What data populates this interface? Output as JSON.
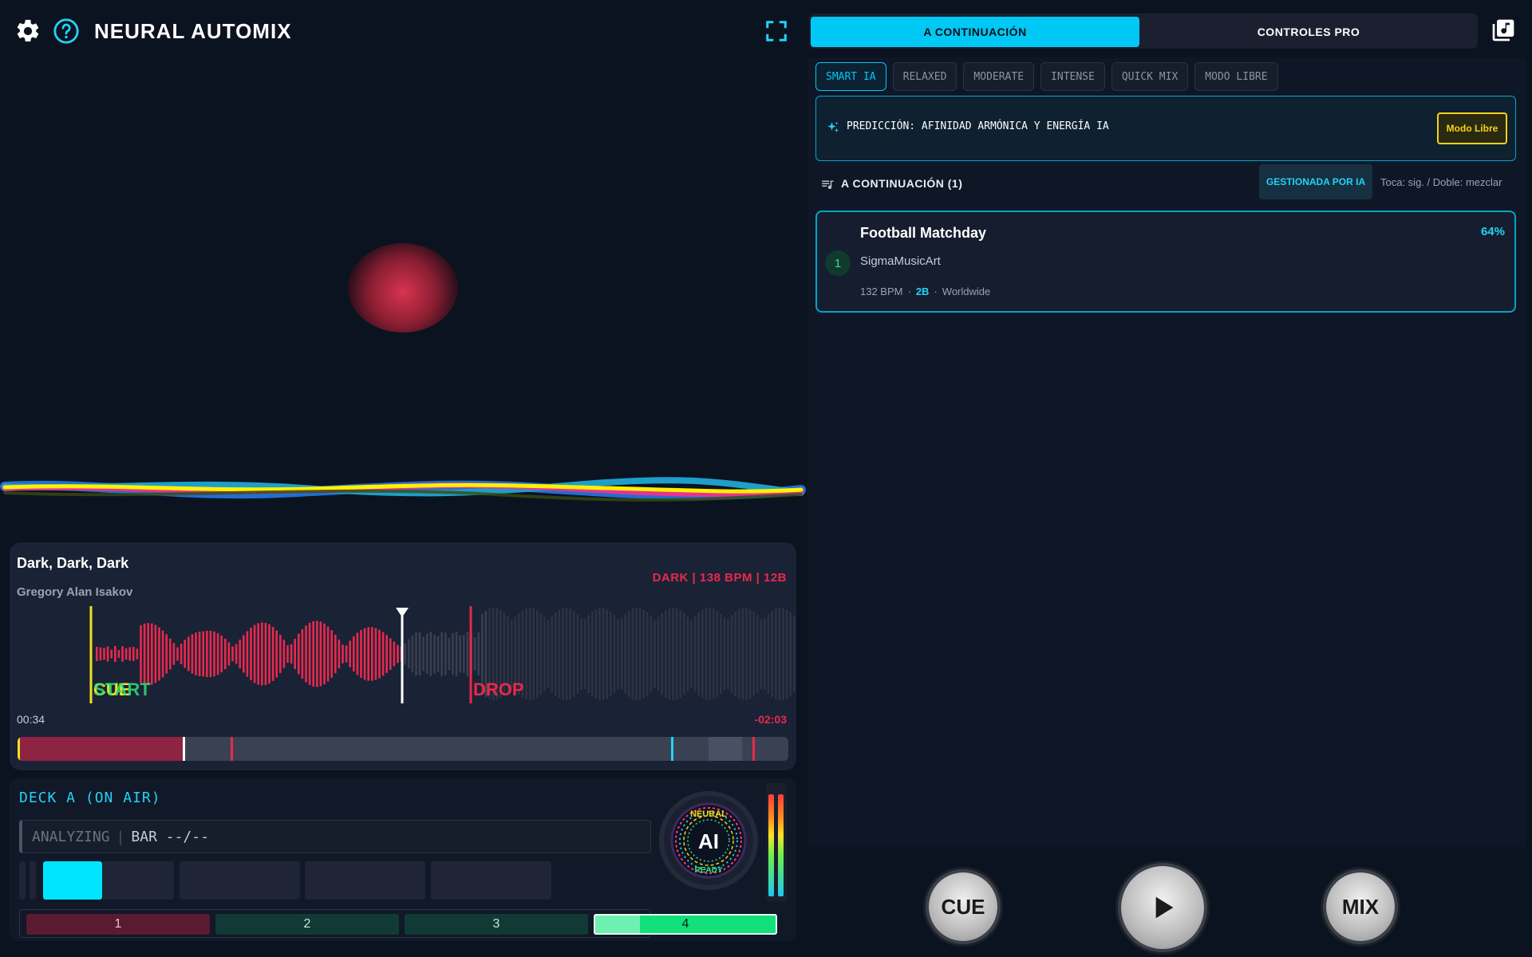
{
  "app": {
    "title": "NEURAL AUTOMIX"
  },
  "deck": {
    "title": "Dark, Dark, Dark",
    "artist": "Gregory Alan Isakov",
    "meta": "DARK | 138 BPM | 12B",
    "markers": {
      "cue": "CUE",
      "start": "START",
      "drop": "DROP"
    },
    "time_elapsed": "00:34",
    "time_remaining": "-02:03",
    "progress_fraction": 0.215
  },
  "deck_control": {
    "label": "DECK A (ON AIR)",
    "analyze_status": "ANALYZING",
    "analyze_bar": "BAR --/--",
    "pads": [
      "1",
      "2",
      "3",
      "4"
    ],
    "ai_knob": {
      "top": "NEURAL",
      "center": "AI",
      "bottom": "READY"
    }
  },
  "tabs": {
    "active": "A CONTINUACIÓN",
    "inactive": "CONTROLES PRO"
  },
  "modes": [
    "SMART IA",
    "RELAXED",
    "MODERATE",
    "INTENSE",
    "QUICK MIX",
    "MODO LIBRE"
  ],
  "prediction": {
    "text": "PREDICCIÓN: AFINIDAD ARMÓNICA Y ENERGÍA IA",
    "button": "Modo Libre"
  },
  "queue": {
    "title": "A CONTINUACIÓN (1)",
    "badge": "GESTIONADA POR IA",
    "hint": "Toca: sig. / Doble: mezclar",
    "items": [
      {
        "num": "1",
        "title": "Football Matchday",
        "artist": "SigmaMusicArt",
        "bpm": "132 BPM",
        "key": "2B",
        "region": "Worldwide",
        "match": "64%"
      }
    ]
  },
  "transport": {
    "cue": "CUE",
    "mix": "MIX"
  },
  "colors": {
    "accent": "#00c8f5",
    "alert": "#e8294d",
    "yellow": "#f5d312",
    "green": "#2fe09a"
  },
  "icons": [
    "gear-icon",
    "help-icon",
    "fullscreen-icon",
    "music-library-icon",
    "sparkle-icon",
    "queue-icon",
    "play-icon"
  ]
}
